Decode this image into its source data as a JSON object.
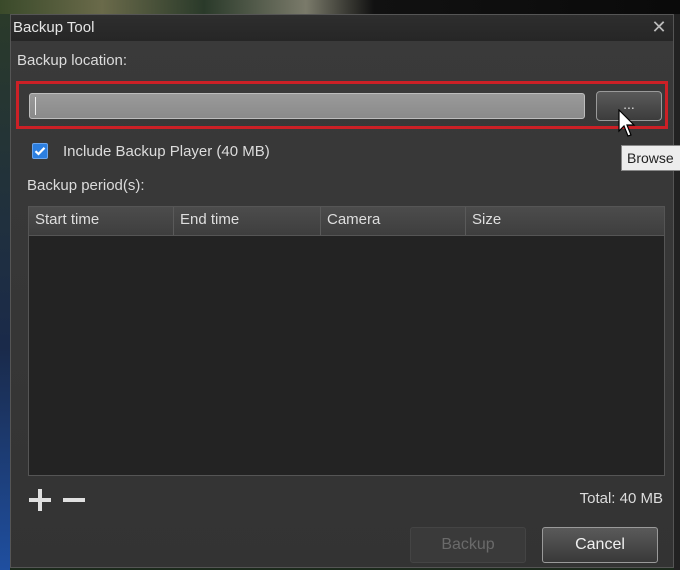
{
  "window": {
    "title": "Backup Tool",
    "close_glyph": "✕"
  },
  "location": {
    "label": "Backup location:",
    "value": "",
    "browse_label": "...",
    "tooltip": "Browse"
  },
  "include_player": {
    "label": "Include Backup Player (40 MB)",
    "checked": true
  },
  "periods": {
    "label": "Backup period(s):",
    "columns": [
      "Start time",
      "End time",
      "Camera",
      "Size"
    ],
    "rows": []
  },
  "footer": {
    "total": "Total: 40 MB",
    "backup_label": "Backup",
    "cancel_label": "Cancel"
  },
  "icons": {
    "add": "plus-icon",
    "remove": "minus-icon",
    "check": "checkmark-icon",
    "pointer": "mouse-pointer-icon"
  },
  "colors": {
    "highlight": "#cc2026",
    "checkbox": "#2c7fe0"
  }
}
